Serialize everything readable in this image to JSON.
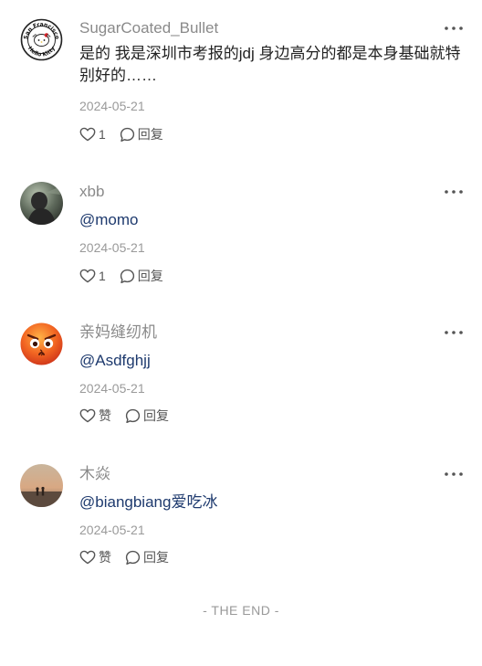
{
  "comments": [
    {
      "username": "SugarCoated_Bullet",
      "text": "是的 我是深圳市考报的jdj 身边高分的都是本身基础就特别好的……",
      "mention": "",
      "date": "2024-05-21",
      "like_label": "1",
      "reply_label": "回复",
      "avatar_badge_top": "San Francisco",
      "avatar_badge_bottom": "Hello Kitty"
    },
    {
      "username": "xbb",
      "text": "",
      "mention": "@momo",
      "date": "2024-05-21",
      "like_label": "1",
      "reply_label": "回复"
    },
    {
      "username": "亲妈缝纫机",
      "text": "",
      "mention": "@Asdfghjj",
      "date": "2024-05-21",
      "like_label": "赞",
      "reply_label": "回复"
    },
    {
      "username": "木焱",
      "text": "",
      "mention": "@biangbiang爱吃冰",
      "date": "2024-05-21",
      "like_label": "赞",
      "reply_label": "回复"
    }
  ],
  "footer": {
    "end_label": "- THE END -"
  },
  "icons": {
    "like": "heart-icon",
    "reply": "chat-bubble-icon",
    "more": "more-dots-icon"
  },
  "colors": {
    "username": "#8a8a8a",
    "mention": "#1e3a6e",
    "date": "#9a9a9a",
    "action": "#555555"
  }
}
